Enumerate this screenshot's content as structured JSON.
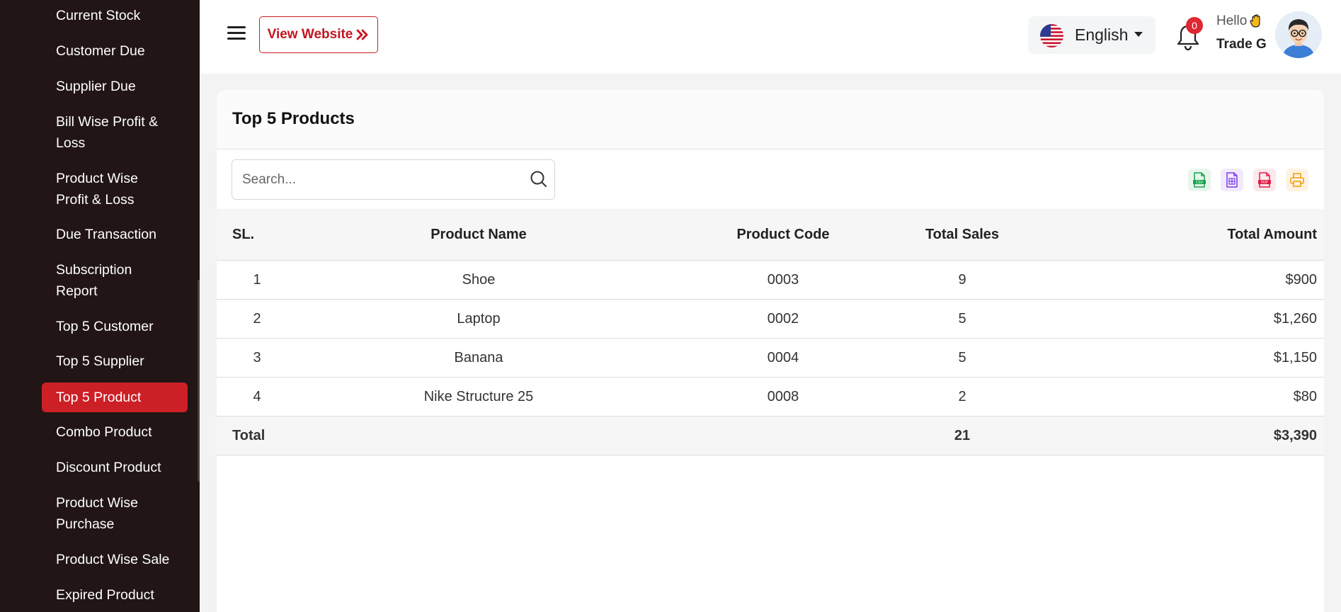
{
  "sidebar": {
    "items": [
      {
        "label": "Current Stock",
        "active": false
      },
      {
        "label": "Customer Due",
        "active": false
      },
      {
        "label": "Supplier Due",
        "active": false
      },
      {
        "label": "Bill Wise Profit & Loss",
        "active": false
      },
      {
        "label": "Product Wise Profit & Loss",
        "active": false
      },
      {
        "label": "Due Transaction",
        "active": false
      },
      {
        "label": "Subscription Report",
        "active": false
      },
      {
        "label": "Top 5 Customer",
        "active": false
      },
      {
        "label": "Top 5 Supplier",
        "active": false
      },
      {
        "label": "Top 5 Product",
        "active": true
      },
      {
        "label": "Combo Product",
        "active": false
      },
      {
        "label": "Discount Product",
        "active": false
      },
      {
        "label": "Product Wise Purchase",
        "active": false
      },
      {
        "label": "Product Wise Sale",
        "active": false
      },
      {
        "label": "Expired Product",
        "active": false
      }
    ]
  },
  "header": {
    "view_website_label": "View Website",
    "language": "English",
    "notification_count": "0",
    "greeting": "Hello",
    "user_name": "Trade G"
  },
  "card": {
    "title": "Top 5 Products",
    "search_placeholder": "Search...",
    "export_buttons": [
      {
        "name": "csv-export-button",
        "icon": "csv-file-icon",
        "color": "#16a34a",
        "bg": "#e7f6ec"
      },
      {
        "name": "excel-export-button",
        "icon": "excel-file-icon",
        "color": "#7c3aed",
        "bg": "#f1e9fd"
      },
      {
        "name": "pdf-export-button",
        "icon": "pdf-file-icon",
        "color": "#e11d48",
        "bg": "#fde8ec"
      },
      {
        "name": "print-button",
        "icon": "printer-icon",
        "color": "#f59e0b",
        "bg": "#fef3e2"
      }
    ]
  },
  "table": {
    "headers": {
      "sl": "SL.",
      "name": "Product Name",
      "code": "Product Code",
      "sales": "Total Sales",
      "amount": "Total Amount"
    },
    "rows": [
      {
        "sl": "1",
        "name": "Shoe",
        "code": "0003",
        "sales": "9",
        "amount": "$900"
      },
      {
        "sl": "2",
        "name": "Laptop",
        "code": "0002",
        "sales": "5",
        "amount": "$1,260"
      },
      {
        "sl": "3",
        "name": "Banana",
        "code": "0004",
        "sales": "5",
        "amount": "$1,150"
      },
      {
        "sl": "4",
        "name": "Nike Structure 25",
        "code": "0008",
        "sales": "2",
        "amount": "$80"
      }
    ],
    "total": {
      "label": "Total",
      "sales": "21",
      "amount": "$3,390"
    }
  },
  "colors": {
    "accent": "#cd1f26",
    "sidebar_bg": "#211516"
  }
}
